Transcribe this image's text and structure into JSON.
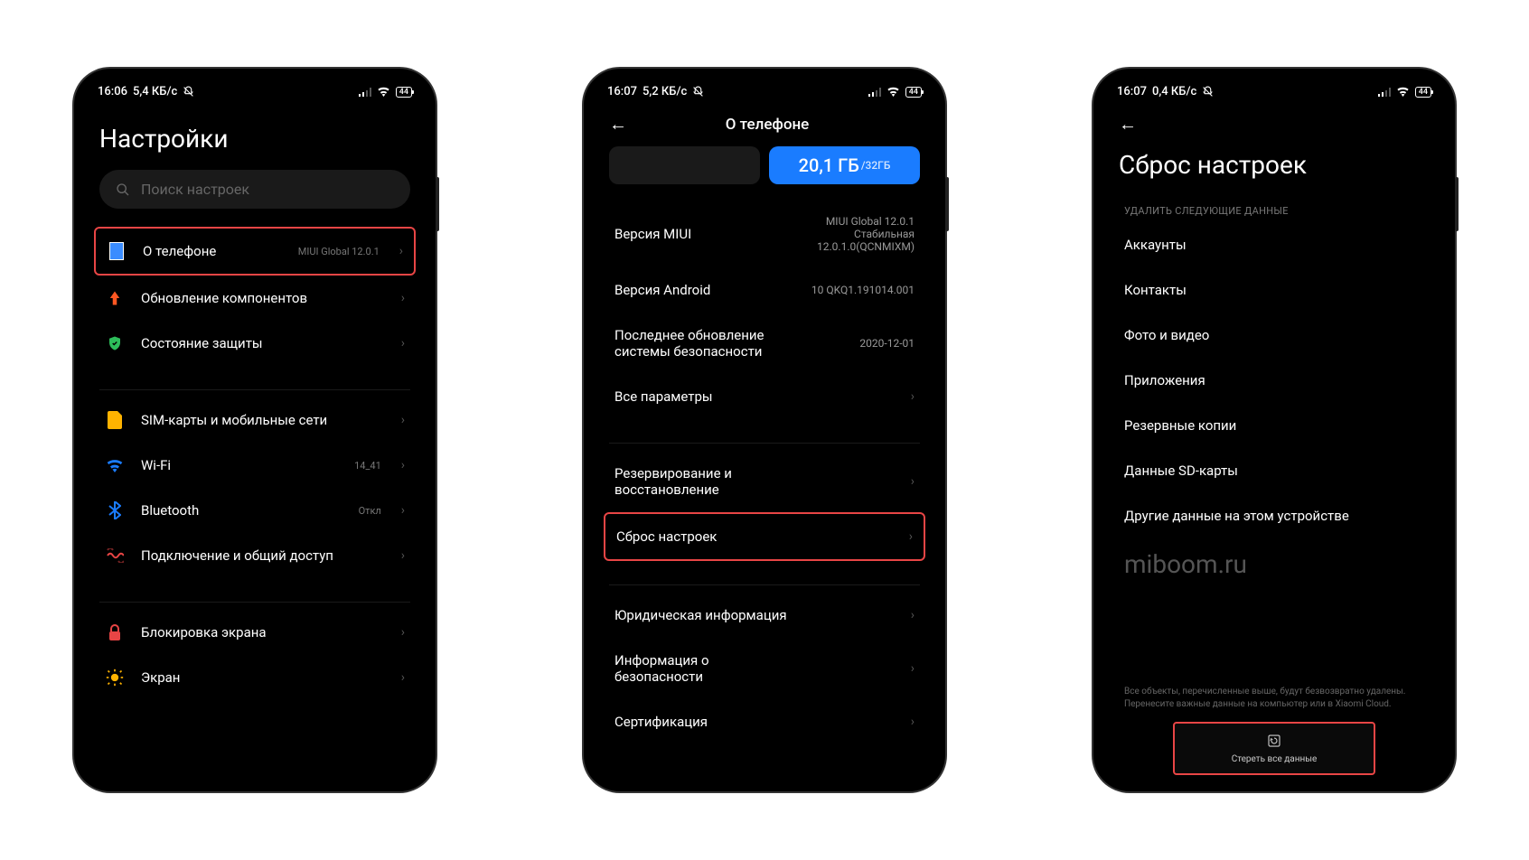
{
  "phone1": {
    "status": {
      "time": "16:06",
      "speed": "5,4 КБ/с",
      "battery": "44"
    },
    "title": "Настройки",
    "search_placeholder": "Поиск настроек",
    "rows": {
      "about": {
        "label": "О телефоне",
        "sub": "MIUI Global 12.0.1"
      },
      "update": {
        "label": "Обновление компонентов"
      },
      "security": {
        "label": "Состояние защиты"
      },
      "sim": {
        "label": "SIM-карты и мобильные сети"
      },
      "wifi": {
        "label": "Wi-Fi",
        "sub": "14_41"
      },
      "bt": {
        "label": "Bluetooth",
        "sub": "Откл"
      },
      "share": {
        "label": "Подключение и общий доступ"
      },
      "lock": {
        "label": "Блокировка экрана"
      },
      "display": {
        "label": "Экран"
      }
    }
  },
  "phone2": {
    "status": {
      "time": "16:07",
      "speed": "5,2 КБ/с",
      "battery": "44"
    },
    "header": "О телефоне",
    "storage": {
      "used": "20,1 ГБ",
      "total": "/32ГБ"
    },
    "rows": {
      "miui": {
        "label": "Версия MIUI",
        "value": "MIUI Global 12.0.1\nСтабильная\n12.0.1.0(QCNMIXM)"
      },
      "android": {
        "label": "Версия Android",
        "value": "10 QKQ1.191014.001"
      },
      "securityupd": {
        "label": "Последнее обновление системы безопасности",
        "value": "2020-12-01"
      },
      "allspecs": {
        "label": "Все параметры"
      },
      "backup": {
        "label": "Резервирование и восстановление"
      },
      "reset": {
        "label": "Сброс настроек"
      },
      "legal": {
        "label": "Юридическая информация"
      },
      "safety": {
        "label": "Информация о безопасности"
      },
      "cert": {
        "label": "Сертификация"
      }
    }
  },
  "phone3": {
    "status": {
      "time": "16:07",
      "speed": "0,4 КБ/с",
      "battery": "44"
    },
    "title": "Сброс настроек",
    "section_head": "УДАЛИТЬ СЛЕДУЮЩИЕ ДАННЫЕ",
    "items": {
      "accounts": "Аккаунты",
      "contacts": "Контакты",
      "media": "Фото и видео",
      "apps": "Приложения",
      "backups": "Резервные копии",
      "sd": "Данные SD-карты",
      "other": "Другие данные на этом устройстве"
    },
    "watermark": "miboom.ru",
    "footer": "Все объекты, перечисленные выше, будут безвозвратно удалены. Перенесите важные данные на компьютер или в Xiaomi Cloud.",
    "erase_btn": "Стереть все данные"
  }
}
